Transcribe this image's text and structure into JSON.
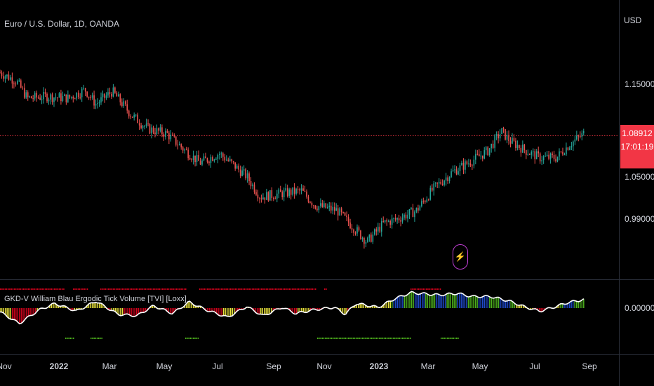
{
  "header": {
    "title": "Euro / U.S. Dollar, 1D, OANDA",
    "currency": "USD"
  },
  "indicator": {
    "title": "GKD-V William Blau Ergodic Tick Volume [TVI] [Loxx]"
  },
  "price_badge": {
    "price": "1.08912",
    "countdown": "17:01:19"
  },
  "colors": {
    "up": "#26a69a",
    "down": "#ef5350",
    "last_price": "#f23645",
    "osc_red": "#d0021b",
    "osc_yellow": "#e8e23a",
    "osc_green": "#4caf1c",
    "osc_blue": "#1e49c8",
    "osc_line": "#ffffff",
    "bolt": "#c23fd6"
  },
  "chart_data": [
    {
      "type": "candlestick",
      "title": "Euro / U.S. Dollar, 1D, OANDA",
      "x_ticks": [
        "Nov",
        "2022",
        "Mar",
        "May",
        "Jul",
        "Sep",
        "Nov",
        "2023",
        "Mar",
        "May",
        "Jul",
        "Sep"
      ],
      "y_ticks": [
        "1.15000",
        "1.05000",
        "0.99000"
      ],
      "y_range": [
        0.945,
        1.175
      ],
      "last_price": 1.08912,
      "path_x_unit": "month (0 = Nov 2021)",
      "price_path": [
        [
          0.0,
          1.162
        ],
        [
          0.6,
          1.152
        ],
        [
          1.0,
          1.132
        ],
        [
          1.7,
          1.134
        ],
        [
          2.5,
          1.132
        ],
        [
          3.1,
          1.142
        ],
        [
          3.5,
          1.125
        ],
        [
          4.1,
          1.14
        ],
        [
          4.8,
          1.112
        ],
        [
          5.4,
          1.096
        ],
        [
          6.1,
          1.09
        ],
        [
          6.7,
          1.072
        ],
        [
          7.3,
          1.056
        ],
        [
          8.0,
          1.067
        ],
        [
          8.5,
          1.054
        ],
        [
          9.0,
          1.04
        ],
        [
          9.5,
          1.016
        ],
        [
          10.3,
          1.02
        ],
        [
          11.0,
          1.023
        ],
        [
          11.5,
          1.006
        ],
        [
          12.3,
          1.0
        ],
        [
          12.9,
          0.98
        ],
        [
          13.4,
          0.963
        ],
        [
          14.0,
          0.985
        ],
        [
          14.5,
          0.99
        ],
        [
          15.2,
          1.0
        ],
        [
          15.8,
          1.025
        ],
        [
          16.5,
          1.045
        ],
        [
          17.2,
          1.058
        ],
        [
          17.8,
          1.07
        ],
        [
          18.3,
          1.093
        ],
        [
          18.6,
          1.082
        ],
        [
          19.2,
          1.07
        ],
        [
          19.7,
          1.062
        ],
        [
          20.3,
          1.062
        ],
        [
          20.8,
          1.078
        ],
        [
          21.3,
          1.09
        ]
      ]
    },
    {
      "type": "bar",
      "title": "GKD-V William Blau Ergodic Tick Volume [TVI] [Loxx]",
      "y_ticks": [
        "0.00000"
      ],
      "osc_x_unit": "month (0 = Nov 2021)",
      "oscillator_path": [
        [
          0.0,
          -0.5
        ],
        [
          0.7,
          -2.0
        ],
        [
          1.4,
          -0.3
        ],
        [
          2.0,
          0.6
        ],
        [
          2.8,
          -0.4
        ],
        [
          3.5,
          0.9
        ],
        [
          4.3,
          -0.8
        ],
        [
          5.0,
          -1.0
        ],
        [
          5.6,
          0.3
        ],
        [
          6.3,
          -0.7
        ],
        [
          6.9,
          0.8
        ],
        [
          7.5,
          -0.2
        ],
        [
          8.3,
          -1.2
        ],
        [
          9.0,
          0.2
        ],
        [
          9.6,
          -1.0
        ],
        [
          10.3,
          0.1
        ],
        [
          10.8,
          -0.7
        ],
        [
          11.5,
          -0.2
        ],
        [
          12.2,
          0.1
        ],
        [
          12.6,
          -0.8
        ],
        [
          13.0,
          0.6
        ],
        [
          13.8,
          0.1
        ],
        [
          14.4,
          1.2
        ],
        [
          15.0,
          2.0
        ],
        [
          16.0,
          1.7
        ],
        [
          16.7,
          1.9
        ],
        [
          17.2,
          1.5
        ],
        [
          17.9,
          1.5
        ],
        [
          18.6,
          0.9
        ],
        [
          19.2,
          0.1
        ],
        [
          19.7,
          -0.4
        ],
        [
          20.2,
          0.1
        ],
        [
          20.7,
          0.7
        ],
        [
          21.3,
          1.1
        ]
      ]
    }
  ]
}
